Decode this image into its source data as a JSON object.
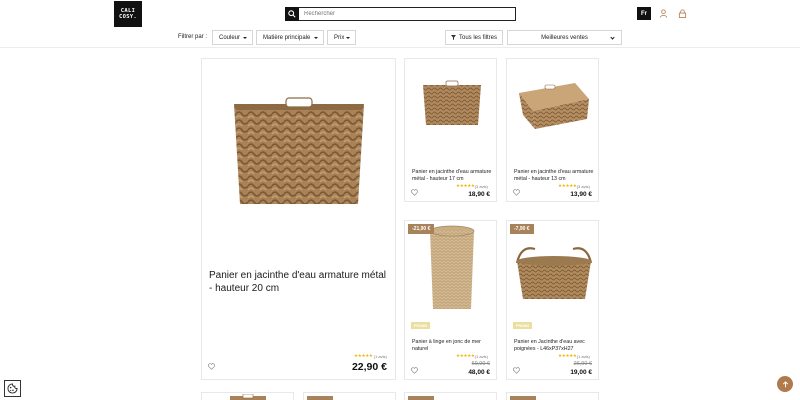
{
  "header": {
    "logo_line1": "CALI",
    "logo_line2": "COSY.",
    "search_placeholder": "Rechercher",
    "language": "Fr",
    "icons": [
      "search-icon",
      "user-icon",
      "lock-icon"
    ]
  },
  "filters": {
    "label": "Filtrer par :",
    "couleur": "Couleur",
    "matiere": "Matière principale",
    "prix": "Prix",
    "all_filters": "Tous les filtres",
    "sort": "Meilleures ventes"
  },
  "products": [
    {
      "title": "Panier en jacinthe d'eau armature métal - hauteur 20 cm",
      "rating_count": "(1 avis)",
      "price": "22,90 €",
      "stars": 5
    },
    {
      "title": "Panier en jacinthe d'eau armature métal - hauteur 17 cm",
      "rating_count": "(3 avis)",
      "price": "18,90 €",
      "stars": 5
    },
    {
      "title": "Panier en jacinthe d'eau armature métal - hauteur 13 cm",
      "rating_count": "(3 avis)",
      "price": "13,90 €",
      "stars": 5
    },
    {
      "title": "Panier à linge en jonc de mer naturel",
      "badge": "-21,90 €",
      "tag": "PROMO",
      "rating_count": "(1 avis)",
      "old_price": "69,90 €",
      "price": "48,00 €",
      "stars": 5
    },
    {
      "title": "Panier en Jacinthe d'eau avec poignées - L46xP37xH27",
      "badge": "-7,90 €",
      "tag": "PROMO",
      "rating_count": "(1 avis)",
      "old_price": "26,90 €",
      "price": "19,00 €",
      "stars": 5
    }
  ],
  "colors": {
    "accent": "#a8825a",
    "scroll_button": "#b17a4d",
    "star": "#f2b600",
    "promo_tag": "#eadf9f"
  }
}
